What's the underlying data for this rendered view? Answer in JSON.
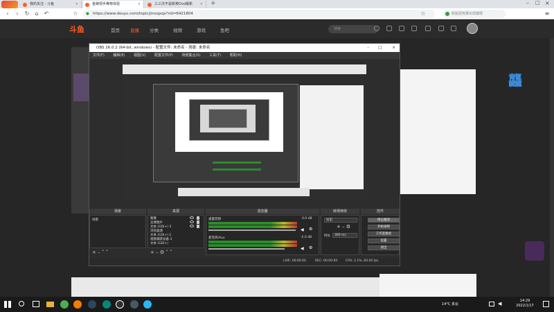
{
  "browser": {
    "tabs": [
      {
        "label": "我的关注 - 斗鱼",
        "active": false
      },
      {
        "label": "金蝶观手推荐体验",
        "active": true
      },
      {
        "label": "三三次不是新英Dvd最新",
        "active": false
      }
    ],
    "url": "https://www.douyu.com/topic/jmxqxqs?rid=6421804",
    "search_placeholder": "新能源竞赛出现爆燃"
  },
  "site": {
    "logo": "斗鱼",
    "nav": [
      "首页",
      "直播",
      "分类",
      "视频",
      "游戏",
      "鱼吧"
    ],
    "nav_active_index": 1,
    "search_placeholder": "搜索"
  },
  "obs": {
    "title": "OBS 26.0.2 (64-bit, windows) - 配置文件: 未命名 - 场景: 未命名",
    "menu": [
      "文件(F)",
      "编辑(E)",
      "视图(V)",
      "配置文件(P)",
      "场景集合(S)",
      "工具(T)",
      "帮助(H)"
    ],
    "docks": {
      "scenes": {
        "title": "场景",
        "items": [
          "场景"
        ]
      },
      "sources": {
        "title": "来源",
        "items": [
          "图像",
          "主要图片",
          "文本 (GDI+) 3",
          "浏览器源",
          "文本 (GDI+) 2",
          "视频捕获设备 3",
          "文本 (GDI+)"
        ]
      },
      "mixer": {
        "title": "混音器",
        "tracks": [
          {
            "name": "桌面音频",
            "db": "0.0 dB"
          },
          {
            "name": "麦克风/Aux",
            "db": "-2.0 dB"
          }
        ]
      },
      "transitions": {
        "title": "转场特效",
        "type": "淡出",
        "duration_label": "时长",
        "duration_value": "300 ms"
      },
      "controls": {
        "title": "控件",
        "buttons": [
          "停止推流",
          "开始录制",
          "工作室模式",
          "设置",
          "退出"
        ]
      }
    },
    "status": {
      "live": "LIVE: 00:00:00",
      "rec": "REC: 00:00:00",
      "cpu": "CPU: 2.1%, 60.00 fps"
    }
  },
  "taskbar": {
    "weather": "14°C 多云",
    "time": "14:29",
    "date": "2022/1/17"
  }
}
